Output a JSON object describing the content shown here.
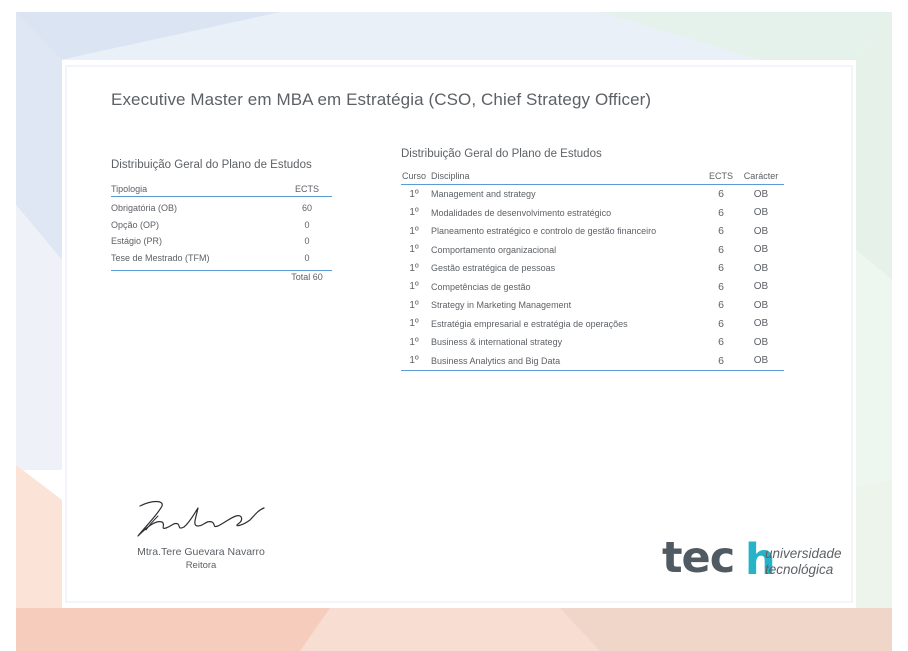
{
  "document": {
    "title": "Executive Master em MBA em Estratégia (CSO, Chief Strategy Officer)"
  },
  "summary": {
    "heading": "Distribuição Geral do Plano de Estudos",
    "col_type": "Tipologia",
    "col_ects": "ECTS",
    "rows": [
      {
        "label": "Obrigatória (OB)",
        "ects": "60"
      },
      {
        "label": "Opção (OP)",
        "ects": "0"
      },
      {
        "label": "Estágio (PR)",
        "ects": "0"
      },
      {
        "label": "Tese de Mestrado (TFM)",
        "ects": "0"
      }
    ],
    "total": "Total 60"
  },
  "courses": {
    "heading": "Distribuição Geral do Plano de Estudos",
    "col_curso": "Curso",
    "col_disciplina": "Disciplina",
    "col_ects": "ECTS",
    "col_caracter": "Carácter",
    "rows": [
      {
        "curso": "1º",
        "disciplina": "Management and strategy",
        "ects": "6",
        "caracter": "OB"
      },
      {
        "curso": "1º",
        "disciplina": "Modalidades de desenvolvimento estratégico",
        "ects": "6",
        "caracter": "OB"
      },
      {
        "curso": "1º",
        "disciplina": "Planeamento estratégico e controlo de gestão financeiro",
        "ects": "6",
        "caracter": "OB"
      },
      {
        "curso": "1º",
        "disciplina": "Comportamento organizacional",
        "ects": "6",
        "caracter": "OB"
      },
      {
        "curso": "1º",
        "disciplina": "Gestão estratégica de pessoas",
        "ects": "6",
        "caracter": "OB"
      },
      {
        "curso": "1º",
        "disciplina": "Competências de gestão",
        "ects": "6",
        "caracter": "OB"
      },
      {
        "curso": "1º",
        "disciplina": "Strategy in Marketing Management",
        "ects": "6",
        "caracter": "OB"
      },
      {
        "curso": "1º",
        "disciplina": "Estratégia empresarial e estratégia de operações",
        "ects": "6",
        "caracter": "OB"
      },
      {
        "curso": "1º",
        "disciplina": "Business & international strategy",
        "ects": "6",
        "caracter": "OB"
      },
      {
        "curso": "1º",
        "disciplina": "Business Analytics and Big Data",
        "ects": "6",
        "caracter": "OB"
      }
    ]
  },
  "signature": {
    "name": "Mtra.Tere Guevara Navarro",
    "role": "Reitora"
  },
  "logo": {
    "word": "tec",
    "accent_letter": "h",
    "line1": "universidade",
    "line2": "tecnológica"
  },
  "colors": {
    "accent": "#5b9bd5",
    "logo_teal": "#26b3c8",
    "logo_gray": "#505a63"
  }
}
